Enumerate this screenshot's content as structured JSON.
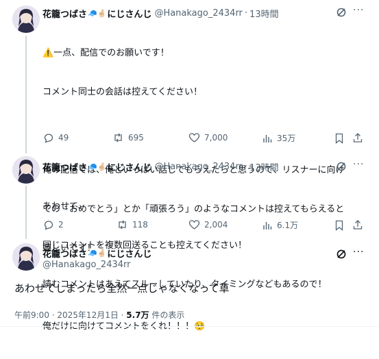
{
  "author": {
    "name": "花籠つばさ",
    "emojis": "🧢🤞🏻",
    "name_suffix": "にじさんじ",
    "handle": "@Hanakago_2434rr"
  },
  "tweets": [
    {
      "time": "13時間",
      "lines": [
        "⚠️一点、配信でのお願いです！",
        "コメント同士の会話は控えてください！",
        "",
        "俺の配信では、俺といっぱい話してもらえたらと思うので、リスナーに向け",
        "ての「おめでとう」とか「頑張ろう」のようなコメントは控えてもらえると",
        "嬉しいです！",
        "",
        "俺だけに向けてコメントをくれ！！！🥺"
      ],
      "replies": "49",
      "reposts": "695",
      "likes": "7,000",
      "views": "35万"
    },
    {
      "time": "13時間",
      "lines": [
        "あわせて、",
        "同じコメントを複数回送ることも控えてください！",
        "読むコメントはあえてスルーしていたり、タイミングなどもあるので！"
      ],
      "replies": "2",
      "reposts": "118",
      "likes": "2,004",
      "views": "6.1万"
    }
  ],
  "main_tweet": {
    "text": "あわせてしまったら全然一点じゃなくなって草",
    "time": "午前9:00 · 2025年12月1日 · ",
    "views": "5.7万",
    "views_suffix": " 件の表示"
  },
  "icons": [
    "grok-icon",
    "more-icon",
    "reply-icon",
    "repost-icon",
    "like-icon",
    "views-icon",
    "bookmark-icon",
    "share-icon"
  ]
}
